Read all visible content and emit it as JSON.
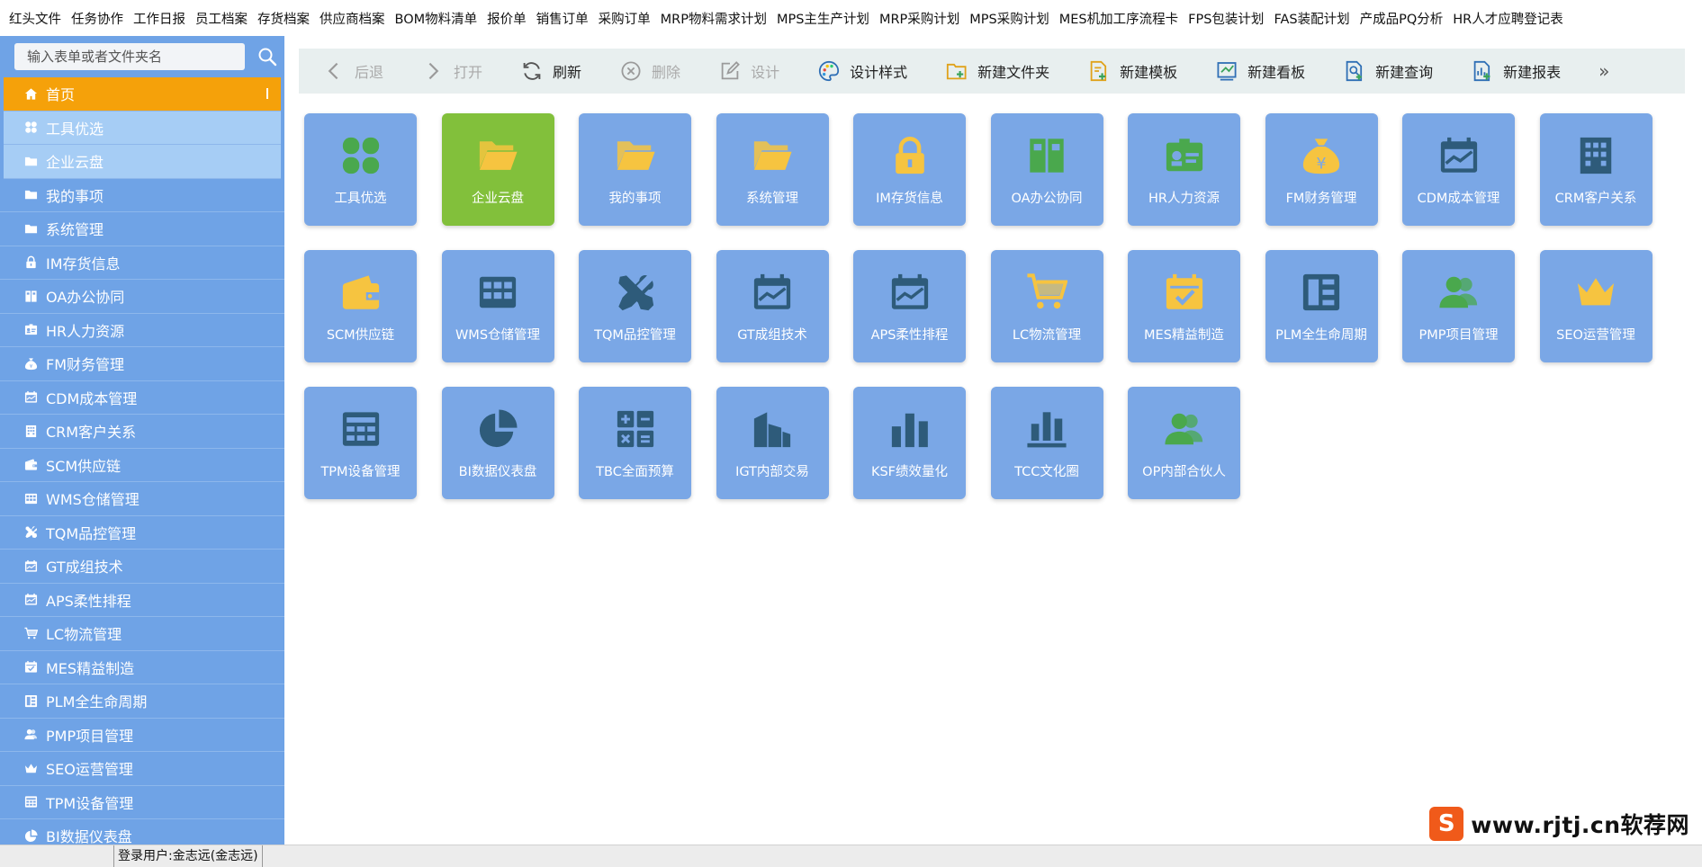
{
  "menubar": [
    "红头文件",
    "任务协作",
    "工作日报",
    "员工档案",
    "存货档案",
    "供应商档案",
    "BOM物料清单",
    "报价单",
    "销售订单",
    "采购订单",
    "MRP物料需求计划",
    "MPS主生产计划",
    "MRP采购计划",
    "MPS采购计划",
    "MES机加工序流程卡",
    "FPS包装计划",
    "FAS装配计划",
    "产成品PQ分析",
    "HR人才应聘登记表"
  ],
  "sidebar": {
    "search_placeholder": "输入表单或者文件夹名",
    "items": [
      {
        "label": "首页",
        "icon": "home-icon",
        "state": "active"
      },
      {
        "label": "工具优选",
        "icon": "grid-icon",
        "state": "highlight"
      },
      {
        "label": "企业云盘",
        "icon": "folder-icon",
        "state": "highlight"
      },
      {
        "label": "我的事项",
        "icon": "folder-icon",
        "state": ""
      },
      {
        "label": "系统管理",
        "icon": "folder-icon",
        "state": ""
      },
      {
        "label": "IM存货信息",
        "icon": "lock-icon",
        "state": ""
      },
      {
        "label": "OA办公协同",
        "icon": "columns-icon",
        "state": ""
      },
      {
        "label": "HR人力资源",
        "icon": "id-card-icon",
        "state": ""
      },
      {
        "label": "FM财务管理",
        "icon": "money-bag-icon",
        "state": ""
      },
      {
        "label": "CDM成本管理",
        "icon": "calendar-chart-icon",
        "state": ""
      },
      {
        "label": "CRM客户关系",
        "icon": "building-icon",
        "state": ""
      },
      {
        "label": "SCM供应链",
        "icon": "wallet-icon",
        "state": ""
      },
      {
        "label": "WMS仓储管理",
        "icon": "table-icon",
        "state": ""
      },
      {
        "label": "TQM品控管理",
        "icon": "tools-icon",
        "state": ""
      },
      {
        "label": "GT成组技术",
        "icon": "calendar-chart-icon",
        "state": ""
      },
      {
        "label": "APS柔性排程",
        "icon": "calendar-chart-icon",
        "state": ""
      },
      {
        "label": "LC物流管理",
        "icon": "cart-icon",
        "state": ""
      },
      {
        "label": "MES精益制造",
        "icon": "calendar-check-icon",
        "state": ""
      },
      {
        "label": "PLM全生命周期",
        "icon": "layout-icon",
        "state": ""
      },
      {
        "label": "PMP项目管理",
        "icon": "users-icon",
        "state": ""
      },
      {
        "label": "SEO运营管理",
        "icon": "crown-icon",
        "state": ""
      },
      {
        "label": "TPM设备管理",
        "icon": "calculator-grid-icon",
        "state": ""
      },
      {
        "label": "BI数据仪表盘",
        "icon": "pie-icon",
        "state": ""
      }
    ]
  },
  "toolbar": [
    {
      "label": "后退",
      "icon": "chevron-left-icon",
      "disabled": true
    },
    {
      "label": "打开",
      "icon": "chevron-right-icon",
      "disabled": true
    },
    {
      "label": "刷新",
      "icon": "refresh-icon",
      "disabled": false
    },
    {
      "label": "删除",
      "icon": "delete-circle-icon",
      "disabled": true
    },
    {
      "label": "设计",
      "icon": "edit-icon",
      "disabled": true
    },
    {
      "label": "设计样式",
      "icon": "palette-icon",
      "disabled": false
    },
    {
      "label": "新建文件夹",
      "icon": "new-folder-icon",
      "disabled": false
    },
    {
      "label": "新建模板",
      "icon": "new-template-icon",
      "disabled": false
    },
    {
      "label": "新建看板",
      "icon": "new-board-icon",
      "disabled": false
    },
    {
      "label": "新建查询",
      "icon": "new-query-icon",
      "disabled": false
    },
    {
      "label": "新建报表",
      "icon": "new-report-icon",
      "disabled": false
    }
  ],
  "toolbar_more": "»",
  "tiles": [
    {
      "label": "工具优选",
      "icon": "clover-grid-icon",
      "green": false
    },
    {
      "label": "企业云盘",
      "icon": "open-folder-icon",
      "green": true
    },
    {
      "label": "我的事项",
      "icon": "open-folder-icon",
      "green": false
    },
    {
      "label": "系统管理",
      "icon": "open-folder-icon",
      "green": false
    },
    {
      "label": "IM存货信息",
      "icon": "lock-icon",
      "green": false
    },
    {
      "label": "OA办公协同",
      "icon": "columns-icon",
      "green": false
    },
    {
      "label": "HR人力资源",
      "icon": "id-card-icon",
      "green": false
    },
    {
      "label": "FM财务管理",
      "icon": "money-bag-icon",
      "green": false
    },
    {
      "label": "CDM成本管理",
      "icon": "calendar-chart-icon",
      "green": false
    },
    {
      "label": "CRM客户关系",
      "icon": "building-icon",
      "green": false
    },
    {
      "label": "SCM供应链",
      "icon": "wallet-icon",
      "green": false
    },
    {
      "label": "WMS仓储管理",
      "icon": "table-icon",
      "green": false
    },
    {
      "label": "TQM品控管理",
      "icon": "tools-icon",
      "green": false
    },
    {
      "label": "GT成组技术",
      "icon": "calendar-chart-icon",
      "green": false
    },
    {
      "label": "APS柔性排程",
      "icon": "calendar-chart-icon",
      "green": false
    },
    {
      "label": "LC物流管理",
      "icon": "cart-icon",
      "green": false
    },
    {
      "label": "MES精益制造",
      "icon": "calendar-check-icon",
      "green": false
    },
    {
      "label": "PLM全生命周期",
      "icon": "layout-icon",
      "green": false
    },
    {
      "label": "PMP项目管理",
      "icon": "users-icon",
      "green": false
    },
    {
      "label": "SEO运营管理",
      "icon": "crown-icon",
      "green": false
    },
    {
      "label": "TPM设备管理",
      "icon": "calculator-grid-icon",
      "green": false
    },
    {
      "label": "BI数据仪表盘",
      "icon": "pie-icon",
      "green": false
    },
    {
      "label": "TBC全面预算",
      "icon": "calculator-icon",
      "green": false
    },
    {
      "label": "IGT内部交易",
      "icon": "buildings-icon",
      "green": false
    },
    {
      "label": "KSF绩效量化",
      "icon": "bar-chart-icon",
      "green": false
    },
    {
      "label": "TCC文化圈",
      "icon": "bar-chart-base-icon",
      "green": false
    },
    {
      "label": "OP内部合伙人",
      "icon": "users-icon",
      "green": false
    }
  ],
  "status": {
    "user": "登录用户:金志远(金志远)"
  },
  "watermark": {
    "logo": "S",
    "text": "www.rjtj.cn软荐网"
  },
  "colors": {
    "sidebar": "#6fa3e6",
    "active": "#f5a10a",
    "highlight": "#a6cdf5",
    "tile": "#7aa7e6",
    "tile_green": "#82c03b",
    "icon_yellow": "#f6c440",
    "icon_green": "#4aa84d",
    "icon_dark": "#2e5b7a"
  }
}
